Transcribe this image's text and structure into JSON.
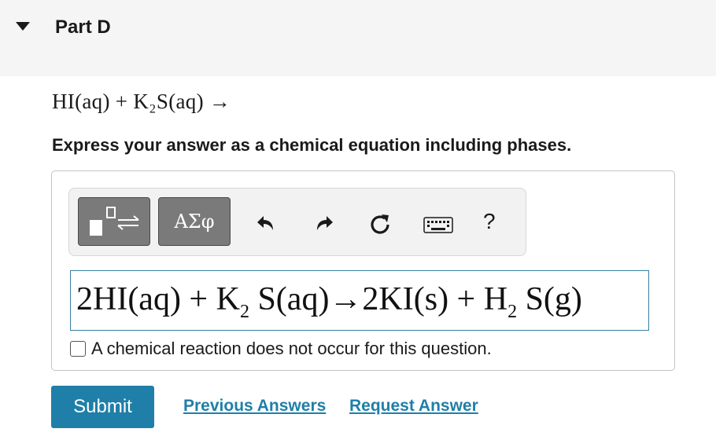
{
  "part": {
    "title": "Part D"
  },
  "question": {
    "text": "HI(aq) + K₂S(aq) →"
  },
  "instruction": "Express your answer as a chemical equation including phases.",
  "toolbar": {
    "symbols_label": "ΑΣφ",
    "help_label": "?",
    "icons": [
      "templates-icon",
      "greek-symbols-icon",
      "undo-icon",
      "redo-icon",
      "reset-icon",
      "keyboard-icon",
      "help-icon"
    ]
  },
  "answer": {
    "p1": "2HI(aq) + K",
    "s1": "2",
    "p2": " S(aq)→2KI(s) + H",
    "s2": "2",
    "p3": " S(g)"
  },
  "no_reaction_label": "A chemical reaction does not occur for this question.",
  "actions": {
    "submit": "Submit",
    "previous_answers": "Previous Answers",
    "request_answer": "Request Answer"
  },
  "colors": {
    "accent": "#1f7fa8",
    "input_border": "#3a7ea1",
    "toolbar_button": "#7a7a7a"
  }
}
